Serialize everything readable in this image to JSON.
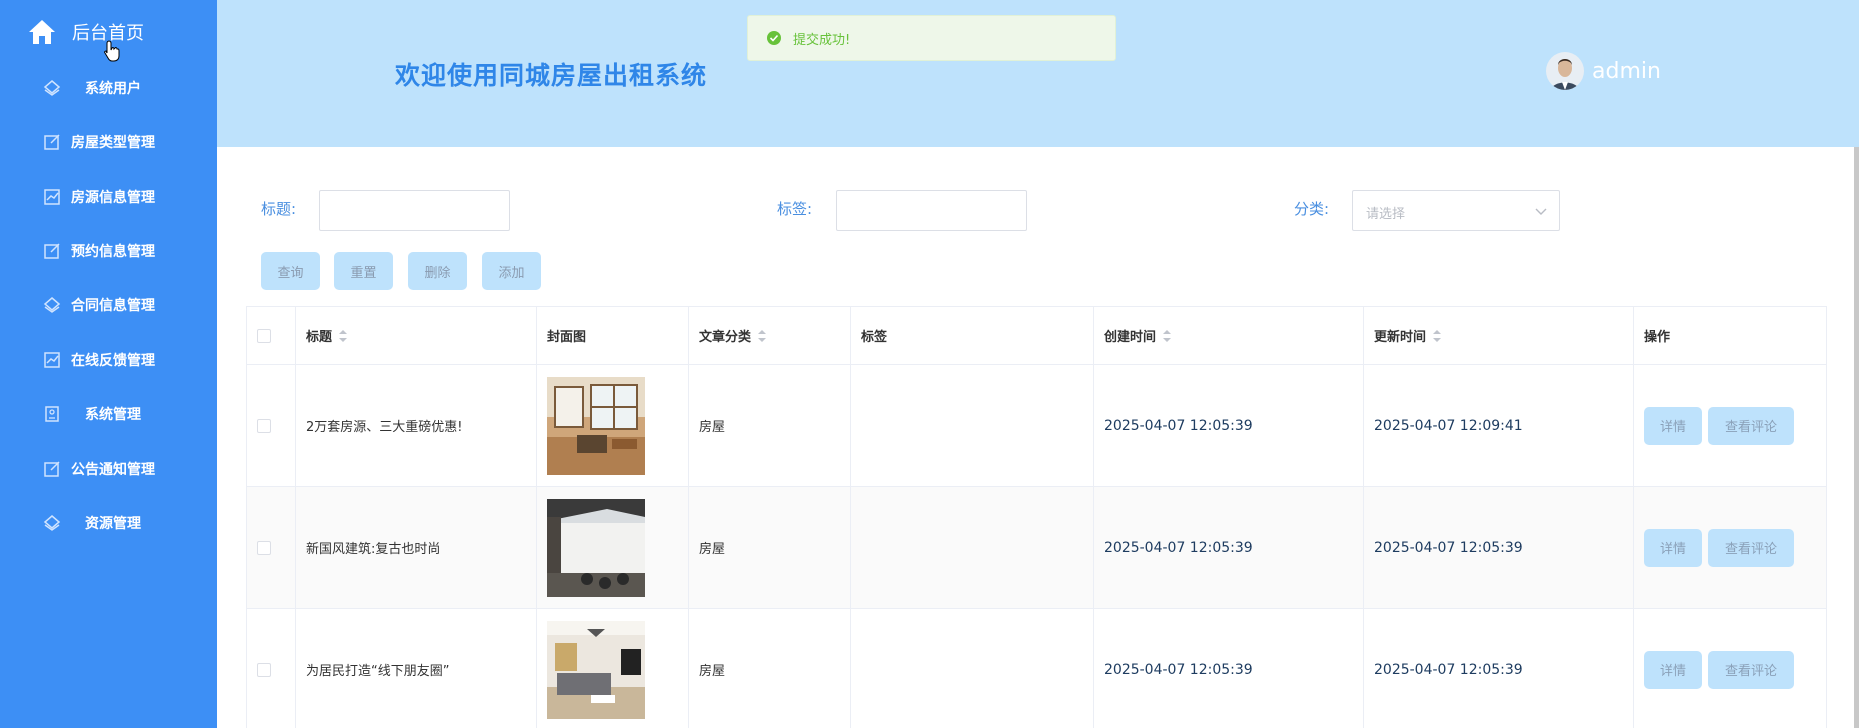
{
  "sidebar": {
    "home_label": "后台首页",
    "items": [
      {
        "label": "系统用户",
        "icon": "layers-icon"
      },
      {
        "label": "房屋类型管理",
        "icon": "edit-icon"
      },
      {
        "label": "房源信息管理",
        "icon": "chart-icon"
      },
      {
        "label": "预约信息管理",
        "icon": "edit-icon"
      },
      {
        "label": "合同信息管理",
        "icon": "layers-icon"
      },
      {
        "label": "在线反馈管理",
        "icon": "chart-icon"
      },
      {
        "label": "系统管理",
        "icon": "id-card-icon"
      },
      {
        "label": "公告通知管理",
        "icon": "edit-icon"
      },
      {
        "label": "资源管理",
        "icon": "layers-icon"
      }
    ]
  },
  "header": {
    "welcome": "欢迎使用同城房屋出租系统",
    "toast": "提交成功!",
    "username": "admin"
  },
  "search": {
    "title_label": "标题:",
    "tag_label": "标签:",
    "category_label": "分类:",
    "category_placeholder": "请选择"
  },
  "buttons": {
    "query": "查询",
    "reset": "重置",
    "delete": "删除",
    "add": "添加"
  },
  "table": {
    "headers": {
      "title": "标题",
      "cover": "封面图",
      "category": "文章分类",
      "tags": "标签",
      "created": "创建时间",
      "updated": "更新时间",
      "actions": "操作"
    },
    "rows": [
      {
        "title": "2万套房源、三大重磅优惠!",
        "category": "房屋",
        "tags": "",
        "created": "2025-04-07 12:05:39",
        "updated": "2025-04-07 12:09:41",
        "detail": "详情",
        "comments": "查看评论"
      },
      {
        "title": "新国风建筑:复古也时尚",
        "category": "房屋",
        "tags": "",
        "created": "2025-04-07 12:05:39",
        "updated": "2025-04-07 12:05:39",
        "detail": "详情",
        "comments": "查看评论"
      },
      {
        "title": "为居民打造“线下朋友圈”",
        "category": "房屋",
        "tags": "",
        "created": "2025-04-07 12:05:39",
        "updated": "2025-04-07 12:05:39",
        "detail": "详情",
        "comments": "查看评论"
      }
    ]
  },
  "colors": {
    "sidebar": "#3d8ff5",
    "header": "#bee2fc",
    "accent": "#2f86e8",
    "success": "#67c23a"
  }
}
